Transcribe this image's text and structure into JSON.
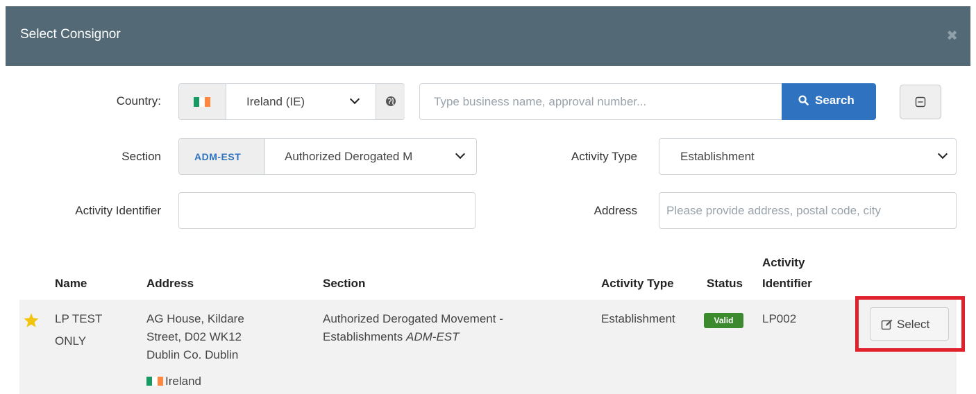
{
  "modal": {
    "title": "Select Consignor",
    "close_icon": "close-icon"
  },
  "filters": {
    "country_label": "Country:",
    "country_value": "Ireland (IE)",
    "search_placeholder": "Type business name, approval number...",
    "search_button": "Search",
    "section_label": "Section",
    "section_code": "ADM-EST",
    "section_value": "Authorized Derogated M",
    "activity_type_label": "Activity Type",
    "activity_type_value": "Establishment",
    "activity_identifier_label": "Activity Identifier",
    "activity_identifier_value": "",
    "address_label": "Address",
    "address_placeholder": "Please provide address, postal code, city"
  },
  "table": {
    "headers": {
      "name": "Name",
      "address": "Address",
      "section": "Section",
      "activity_type": "Activity Type",
      "status": "Status",
      "activity_identifier_1": "Activity",
      "activity_identifier_2": "Identifier"
    },
    "rows": [
      {
        "favorite_icon": "star-icon",
        "name_1": "LP TEST",
        "name_2": "ONLY",
        "address_1": "AG House, Kildare",
        "address_2": "Street, D02 WK12",
        "address_3": "Dublin Co. Dublin",
        "address_country": "Ireland",
        "section_1": "Authorized Derogated Movement -",
        "section_2": "Establishments ",
        "section_code": "ADM-EST",
        "activity_type": "Establishment",
        "status": "Valid",
        "activity_identifier": "LP002",
        "select_button": "Select"
      }
    ]
  },
  "colors": {
    "header_bg": "#536975",
    "search_button": "#2f72c0",
    "status_valid": "#3c8a2e",
    "highlight": "#e0202b",
    "star": "#f2c40f"
  }
}
